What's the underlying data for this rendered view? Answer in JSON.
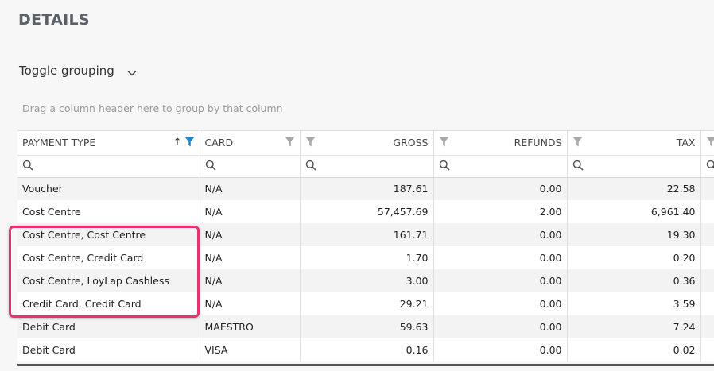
{
  "section": {
    "title": "DETAILS"
  },
  "toggle": {
    "label": "Toggle grouping",
    "icon": "chevron-down-icon"
  },
  "group_panel": {
    "placeholder": "Drag a column header here to group by that column"
  },
  "columns": [
    {
      "label": "PAYMENT TYPE",
      "sorted": "ascending",
      "filter_active": true
    },
    {
      "label": "CARD",
      "filter_active": false
    },
    {
      "label": "GROSS",
      "filter_active": false
    },
    {
      "label": "REFUNDS",
      "filter_active": false
    },
    {
      "label": "TAX",
      "filter_active": false
    }
  ],
  "rows": [
    [
      "Voucher",
      "N/A",
      "187.61",
      "0.00",
      "22.58"
    ],
    [
      "Cost Centre",
      "N/A",
      "57,457.69",
      "2.00",
      "6,961.40"
    ],
    [
      "Cost Centre, Cost Centre",
      "N/A",
      "161.71",
      "0.00",
      "19.30"
    ],
    [
      "Cost Centre, Credit Card",
      "N/A",
      "1.70",
      "0.00",
      "0.20"
    ],
    [
      "Cost Centre, LoyLap Cashless",
      "N/A",
      "3.00",
      "0.00",
      "0.36"
    ],
    [
      "Credit Card, Credit Card",
      "N/A",
      "29.21",
      "0.00",
      "3.59"
    ],
    [
      "Debit Card",
      "MAESTRO",
      "59.63",
      "0.00",
      "7.24"
    ],
    [
      "Debit Card",
      "VISA",
      "0.16",
      "0.00",
      "0.02"
    ]
  ],
  "colors": {
    "filter_active": "#1e88c8",
    "filter_inactive": "#a9a9a9",
    "highlight": "#e8336d"
  }
}
